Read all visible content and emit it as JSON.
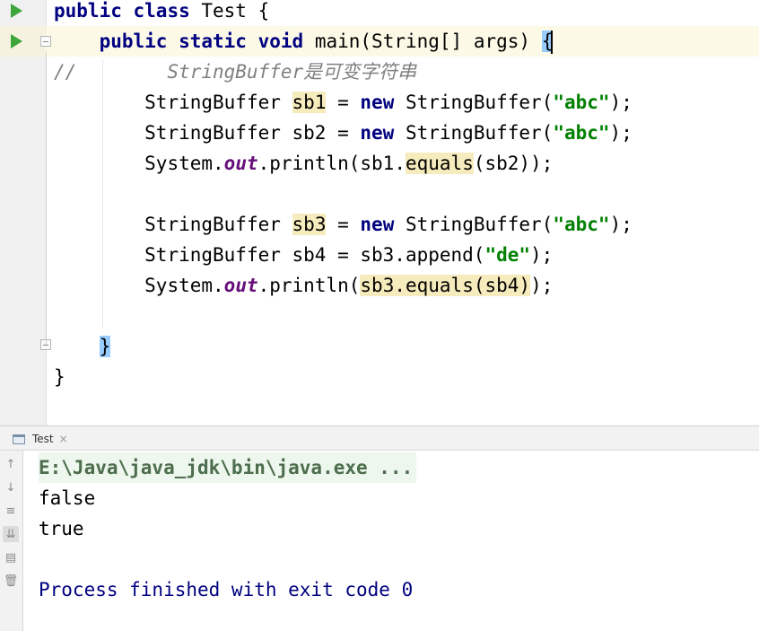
{
  "editor": {
    "lines": {
      "l1": {
        "kw1": "public",
        "kw2": "class",
        "rest": " Test {"
      },
      "l2": {
        "kw1": "public",
        "kw2": "static",
        "kw3": "void",
        "rest": " main(String[] args) ",
        "brace": "{"
      },
      "l3": {
        "comment": "//        StringBuffer是可变字符串"
      },
      "l4": {
        "type": "StringBuffer ",
        "var": "sb1",
        "mid": " = ",
        "kw": "new",
        "ctor": " StringBuffer(",
        "str": "\"abc\"",
        "end": ");"
      },
      "l5": {
        "type": "StringBuffer sb2 = ",
        "kw": "new",
        "ctor": " StringBuffer(",
        "str": "\"abc\"",
        "end": ");"
      },
      "l6": {
        "pre": "System.",
        "field": "out",
        "mid": ".println(sb1.",
        "method": "equals",
        "end": "(sb2));"
      },
      "l8": {
        "type": "StringBuffer ",
        "var": "sb3",
        "mid": " = ",
        "kw": "new",
        "ctor": " StringBuffer(",
        "str": "\"abc\"",
        "end": ");"
      },
      "l9": {
        "pre": "StringBuffer sb4 = sb3.append(",
        "str": "\"de\"",
        "end": ");"
      },
      "l10": {
        "pre": "System.",
        "field": "out",
        "mid": ".println(",
        "hl": "sb3.equals(sb4)",
        "end": ");"
      },
      "l12": {
        "brace": "}"
      },
      "l13": {
        "brace": "}"
      }
    }
  },
  "run_panel": {
    "tab_label": "Test",
    "tab_close": "×",
    "toolbar": {
      "up": "↑",
      "down": "↓",
      "soft_wrap": "≡",
      "scroll_end": "⇊",
      "print": "▤",
      "clear": "🗑"
    },
    "console": {
      "command": "E:\\Java\\java_jdk\\bin\\java.exe ...",
      "output": [
        "false",
        "true"
      ],
      "exit_message": "Process finished with exit code 0"
    }
  },
  "colors": {
    "keyword": "#000080",
    "string": "#008000",
    "static_field": "#660e7a",
    "comment": "#808080",
    "usage_highlight": "#f6ebbc",
    "brace_match": "#99ccff",
    "run_icon": "#3da53a"
  }
}
